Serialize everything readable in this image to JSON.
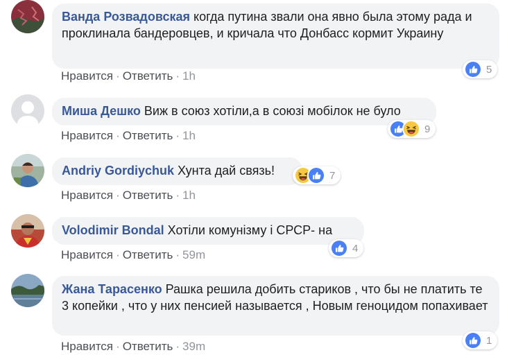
{
  "comments": [
    {
      "author": "Ванда Розвадовская",
      "text": "когда путина звали она явно была этому рада и проклинала бандеровцев, и кричала что Донбасс кормит Украину",
      "like_label": "Нравится",
      "reply_label": "Ответить",
      "time": "1h",
      "reaction_count": "5",
      "reactions": [
        "like-icon"
      ]
    },
    {
      "author": "Миша Дешко",
      "text": "Виж в союз хотіли,а в союзі мобілок не було",
      "like_label": "Нравится",
      "reply_label": "Ответить",
      "time": "1h",
      "reaction_count": "9",
      "reactions": [
        "like-icon",
        "haha-icon"
      ]
    },
    {
      "author": "Andriy Gordiychuk",
      "text": "Хунта дай связь!",
      "like_label": "Нравится",
      "reply_label": "Ответить",
      "time": "1h",
      "reaction_count": "7",
      "reactions": [
        "haha-icon",
        "like-icon"
      ]
    },
    {
      "author": "Volodimir Bondal",
      "text": "Хотіли комунізму і СРСР- на",
      "like_label": "Нравится",
      "reply_label": "Ответить",
      "time": "59m",
      "reaction_count": "4",
      "reactions": [
        "like-icon"
      ]
    },
    {
      "author": "Жана Тарасенко",
      "text": "Рашка решила добить стариков , что бы не платить те 3 копейки , что у них пенсией называется , Новым геноцидом попахивает",
      "like_label": "Нравится",
      "reply_label": "Ответить",
      "time": "39m",
      "reaction_count": "1",
      "reactions": [
        "like-icon"
      ]
    }
  ],
  "colors": {
    "author": "#385898",
    "bubble": "#f2f3f5",
    "like": "#4a80f5",
    "haha": "#f7c843"
  }
}
